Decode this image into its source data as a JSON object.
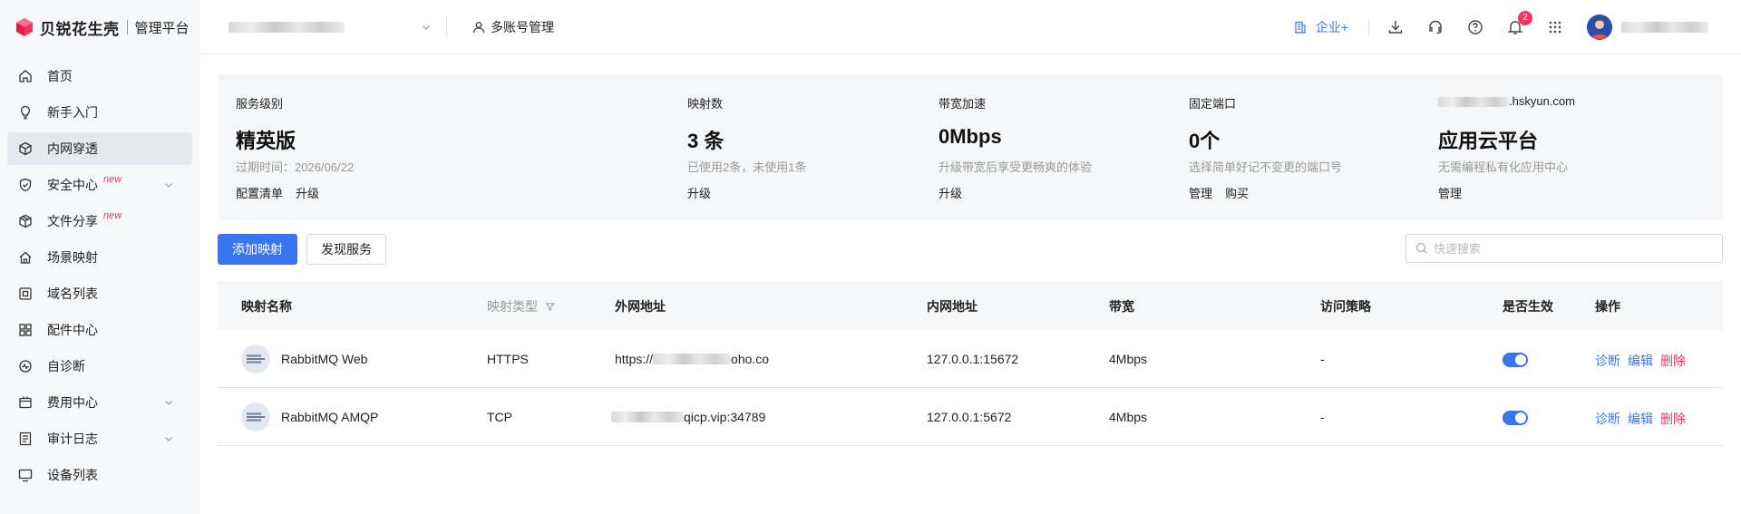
{
  "brand": {
    "name": "贝锐花生壳",
    "subtitle": "管理平台",
    "colors": {
      "brand": "#f5325c",
      "accent": "#3a75f0"
    }
  },
  "sidebar": {
    "items": [
      {
        "label": "首页",
        "icon": "home-icon"
      },
      {
        "label": "新手入门",
        "icon": "bulb-icon"
      },
      {
        "label": "内网穿透",
        "icon": "cube-icon",
        "active": true
      },
      {
        "label": "安全中心",
        "icon": "shield-icon",
        "badge": "new",
        "expandable": true
      },
      {
        "label": "文件分享",
        "icon": "box-icon",
        "badge": "new"
      },
      {
        "label": "场景映射",
        "icon": "house-icon"
      },
      {
        "label": "域名列表",
        "icon": "domain-icon"
      },
      {
        "label": "配件中心",
        "icon": "grid-icon"
      },
      {
        "label": "自诊断",
        "icon": "diagnose-icon"
      },
      {
        "label": "费用中心",
        "icon": "wallet-icon",
        "expandable": true
      },
      {
        "label": "审计日志",
        "icon": "log-icon",
        "expandable": true
      },
      {
        "label": "设备列表",
        "icon": "monitor-icon"
      }
    ]
  },
  "header": {
    "multi_account": "多账号管理",
    "enterprise": "企业+",
    "notification_count": "2"
  },
  "summary": {
    "service_level": {
      "label": "服务级别",
      "value": "精英版",
      "desc": "过期时间：2026/06/22",
      "links": [
        "配置清单",
        "升级"
      ]
    },
    "mappings": {
      "label": "映射数",
      "value": "3 条",
      "desc": "已使用2条，未使用1条",
      "links": [
        "升级"
      ]
    },
    "bandwidth": {
      "label": "带宽加速",
      "value": "0Mbps",
      "desc": "升级带宽后享受更畅爽的体验",
      "links": [
        "升级"
      ]
    },
    "fixed_port": {
      "label": "固定端口",
      "value": "0个",
      "desc": "选择简单好记不变更的端口号",
      "links": [
        "管理",
        "购买"
      ]
    },
    "app_cloud": {
      "label_suffix": ".hskyun.com",
      "value": "应用云平台",
      "desc": "无需编程私有化应用中心",
      "links": [
        "管理"
      ]
    }
  },
  "toolbar": {
    "add_label": "添加映射",
    "discover_label": "发现服务",
    "search_placeholder": "快速搜索"
  },
  "table": {
    "columns": [
      "映射名称",
      "映射类型",
      "外网地址",
      "内网地址",
      "带宽",
      "访问策略",
      "是否生效",
      "操作"
    ],
    "rows": [
      {
        "name": "RabbitMQ Web",
        "type": "HTTPS",
        "external_prefix": "https://",
        "external_suffix": "oho.co",
        "internal": "127.0.0.1:15672",
        "bandwidth": "4Mbps",
        "policy": "-",
        "enabled": true
      },
      {
        "name": "RabbitMQ AMQP",
        "type": "TCP",
        "external_prefix": "",
        "external_suffix": "qicp.vip:34789",
        "internal": "127.0.0.1:5672",
        "bandwidth": "4Mbps",
        "policy": "-",
        "enabled": true
      }
    ],
    "actions": {
      "diagnose": "诊断",
      "edit": "编辑",
      "delete": "删除"
    }
  }
}
